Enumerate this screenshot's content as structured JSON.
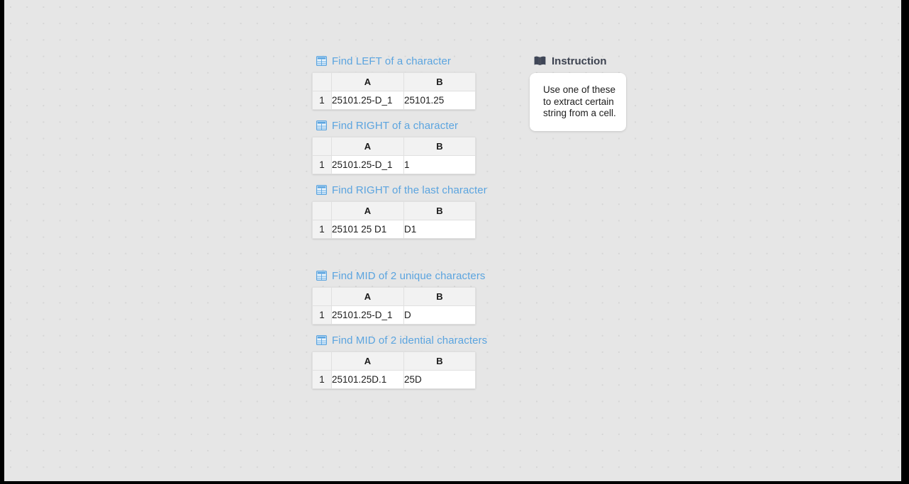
{
  "theme": {
    "canvas_bg": "#e6e6e6",
    "dot_color": "#d6d6d6",
    "title_blue": "#5ba4df",
    "instruction_title_color": "#3c4250",
    "sheet_header_bg": "#f2f2f2",
    "frame_color": "#000000"
  },
  "icons": {
    "table": "table-icon",
    "book": "book-icon"
  },
  "blocks": [
    {
      "title": "Find LEFT of a character",
      "icon": "table-icon",
      "columns": [
        "A",
        "B"
      ],
      "rows": [
        {
          "index": "1",
          "a": "25101.25-D_1",
          "b": "25101.25"
        }
      ]
    },
    {
      "title": "Find RIGHT of a character",
      "icon": "table-icon",
      "columns": [
        "A",
        "B"
      ],
      "rows": [
        {
          "index": "1",
          "a": "25101.25-D_1",
          "b": "1"
        }
      ]
    },
    {
      "title": "Find RIGHT of the last character",
      "icon": "table-icon",
      "columns": [
        "A",
        "B"
      ],
      "rows": [
        {
          "index": "1",
          "a": "25101 25 D1",
          "b": "D1"
        }
      ]
    },
    {
      "title": "Find MID of 2 unique characters",
      "icon": "table-icon",
      "columns": [
        "A",
        "B"
      ],
      "rows": [
        {
          "index": "1",
          "a": "25101.25-D_1",
          "b": "D"
        }
      ]
    },
    {
      "title": "Find MID of 2 idential characters",
      "icon": "table-icon",
      "columns": [
        "A",
        "B"
      ],
      "rows": [
        {
          "index": "1",
          "a": "25101.25D.1",
          "b": "25D"
        }
      ]
    }
  ],
  "instruction": {
    "title": "Instruction",
    "icon": "book-icon",
    "text": "Use one of these to extract certain string from a cell."
  }
}
